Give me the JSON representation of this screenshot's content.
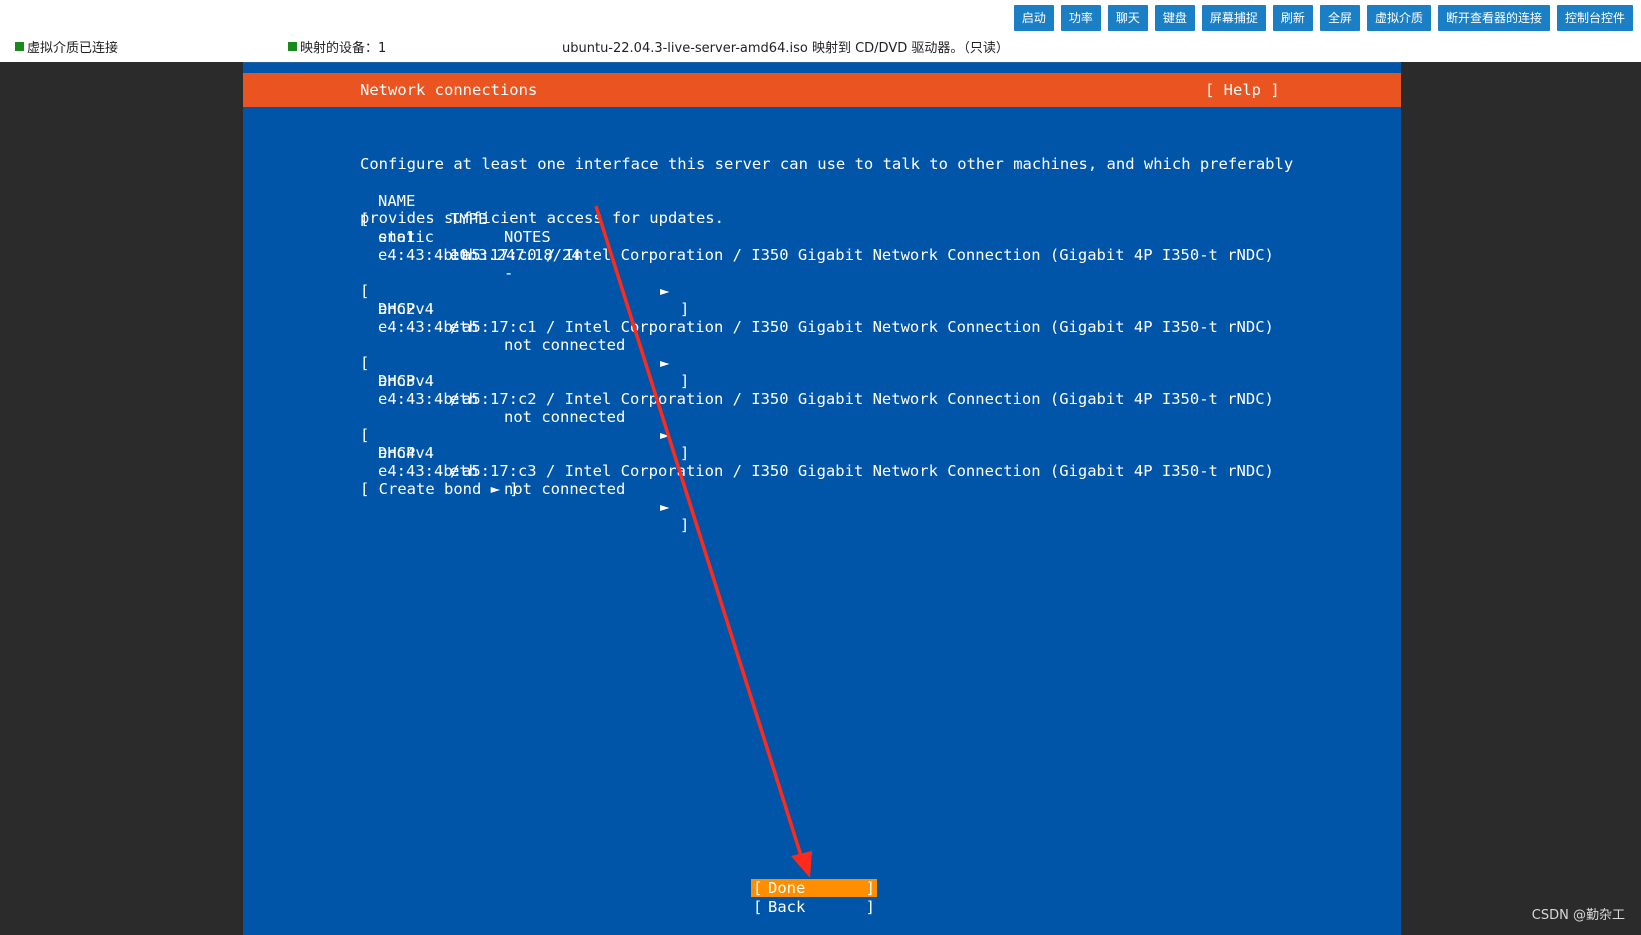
{
  "toolbar": {
    "buttons": [
      "启动",
      "功率",
      "聊天",
      "键盘",
      "屏幕捕捉",
      "刷新",
      "全屏",
      "虚拟介质",
      "断开查看器的连接",
      "控制台控件"
    ]
  },
  "status": {
    "media": "虚拟介质已连接",
    "devices": "映射的设备：1",
    "iso": "ubuntu-22.04.3-live-server-amd64.iso 映射到 CD/DVD 驱动器。（只读）"
  },
  "console": {
    "title": "Network connections",
    "help": "[ Help ]",
    "description": [
      "Configure at least one interface this server can use to talk to other machines, and which preferably",
      "provides sufficient access for updates."
    ],
    "columns": {
      "name": "NAME",
      "type": "TYPE",
      "notes": "NOTES"
    },
    "interfaces": [
      {
        "name": "eno1",
        "type": "eth",
        "notes": "-",
        "addr_mode": "static",
        "addr": "10.3.247.18/24",
        "hw": "e4:43:4b:a5:17:c0 / Intel Corporation / I350 Gigabit Network Connection (Gigabit 4P I350-t rNDC)"
      },
      {
        "name": "eno2",
        "type": "eth",
        "notes": "not connected",
        "addr_mode": "DHCPv4",
        "addr": "/",
        "hw": "e4:43:4b:a5:17:c1 / Intel Corporation / I350 Gigabit Network Connection (Gigabit 4P I350-t rNDC)"
      },
      {
        "name": "eno3",
        "type": "eth",
        "notes": "not connected",
        "addr_mode": "DHCPv4",
        "addr": "/",
        "hw": "e4:43:4b:a5:17:c2 / Intel Corporation / I350 Gigabit Network Connection (Gigabit 4P I350-t rNDC)"
      },
      {
        "name": "eno4",
        "type": "eth",
        "notes": "not connected",
        "addr_mode": "DHCPv4",
        "addr": "/",
        "hw": "e4:43:4b:a5:17:c3 / Intel Corporation / I350 Gigabit Network Connection (Gigabit 4P I350-t rNDC)"
      }
    ],
    "bracket_left": "[",
    "bracket_right": "]",
    "arrow": "►",
    "create_bond": "[ Create bond ► ]",
    "done_label": "Done",
    "back_label": "Back"
  },
  "annotation_color": "#ff2a1a",
  "watermark": "CSDN @勤杂工"
}
